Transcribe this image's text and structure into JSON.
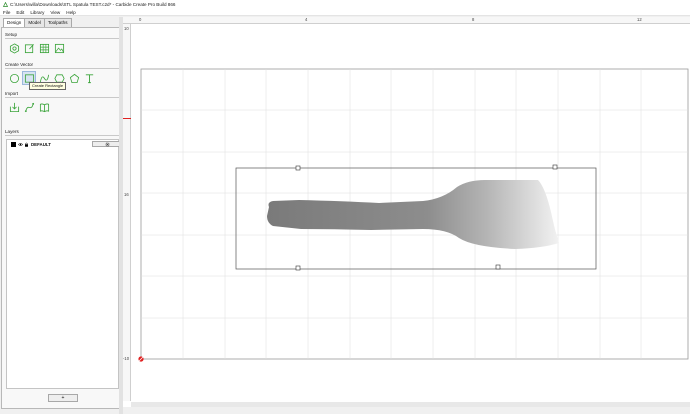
{
  "window": {
    "title": "C:\\Users\\willa\\Downloads\\STL Spatula TEST.c2d* - Carbide Create Pro Build 866"
  },
  "menu": [
    "File",
    "Edit",
    "Library",
    "View",
    "Help"
  ],
  "tabs": [
    {
      "label": "Design",
      "active": true
    },
    {
      "label": "Model",
      "active": false
    },
    {
      "label": "Toolpaths",
      "active": false
    }
  ],
  "sections": {
    "setup": "Setup",
    "create_vector": "Create Vector",
    "import": "Import",
    "layers": "Layers"
  },
  "setup_tools": [
    "settings-hex-icon",
    "edit-document-icon",
    "grid-icon",
    "image-icon"
  ],
  "vector_tools": [
    "circle-icon",
    "rectangle-icon",
    "curve-icon",
    "polygon-icon",
    "pentagon-icon",
    "text-icon"
  ],
  "import_tools": [
    "import-arrow-icon",
    "import-path-icon",
    "book-icon"
  ],
  "tooltip": "Create Rectangle",
  "layers": [
    {
      "name": "DEFAULT",
      "color": "#000000"
    }
  ],
  "add_layer_label": "+",
  "ruler": {
    "top": [
      "0",
      "4",
      "8",
      "12"
    ],
    "left": [
      "10",
      "16",
      "-10"
    ]
  },
  "colors": {
    "tool_green": "#3aa43a",
    "origin_red": "#e02020"
  }
}
